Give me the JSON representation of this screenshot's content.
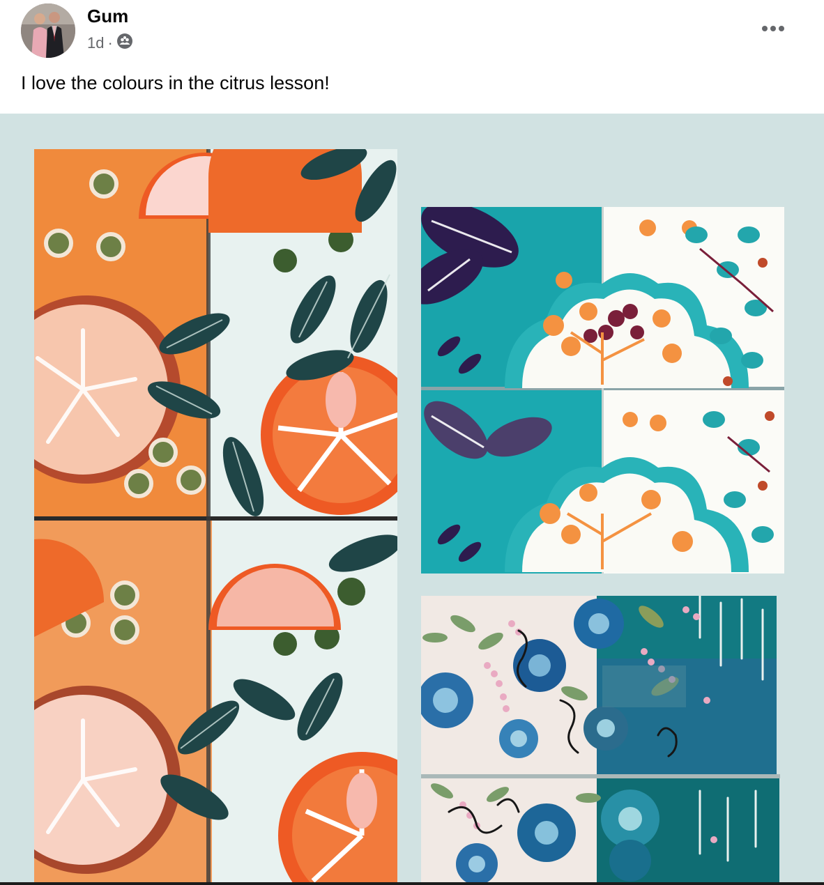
{
  "post": {
    "author": "Gum",
    "time": "1d",
    "separator": "·",
    "audience_icon": "friends-icon",
    "text": "I love the colours in the citrus lesson!",
    "more_icon": "more-options-icon"
  },
  "media": {
    "background": "#d1e2e2",
    "photos": [
      {
        "subject": "citrus-painting",
        "palette": [
          "#f08a3c",
          "#ee5a24",
          "#e8f2f0",
          "#1f4547",
          "#6d8046",
          "#f4c0b5"
        ]
      },
      {
        "subject": "teal-tree-painting",
        "palette": [
          "#19a4ab",
          "#f49241",
          "#fbfbf7",
          "#2d1c4e",
          "#7a1f3a"
        ]
      },
      {
        "subject": "blue-floral-painting",
        "palette": [
          "#2a6fa8",
          "#127a82",
          "#f1e9e4",
          "#e9aac2",
          "#7a9d6a"
        ]
      }
    ]
  }
}
